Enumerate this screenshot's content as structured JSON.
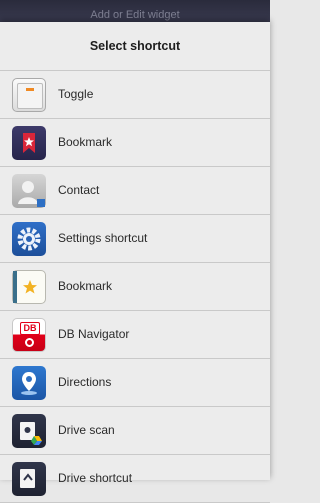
{
  "background_header": {
    "text": "Add or Edit widget"
  },
  "dialog": {
    "title": "Select shortcut",
    "items": [
      {
        "label": "Toggle",
        "icon": "toggle-icon"
      },
      {
        "label": "Bookmark",
        "icon": "bookmark-star-icon"
      },
      {
        "label": "Contact",
        "icon": "contact-icon"
      },
      {
        "label": "Settings shortcut",
        "icon": "settings-gear-icon"
      },
      {
        "label": "Bookmark",
        "icon": "bookmark-star-icon"
      },
      {
        "label": "DB Navigator",
        "icon": "db-navigator-icon"
      },
      {
        "label": "Directions",
        "icon": "directions-pin-icon"
      },
      {
        "label": "Drive scan",
        "icon": "drive-scan-icon"
      },
      {
        "label": "Drive shortcut",
        "icon": "drive-shortcut-icon"
      }
    ]
  },
  "icon_text": {
    "db_logo": "DB"
  },
  "colors": {
    "sheet_background": "#ececec",
    "divider": "#c9c9c9",
    "header_background": "#2a2b3c"
  }
}
